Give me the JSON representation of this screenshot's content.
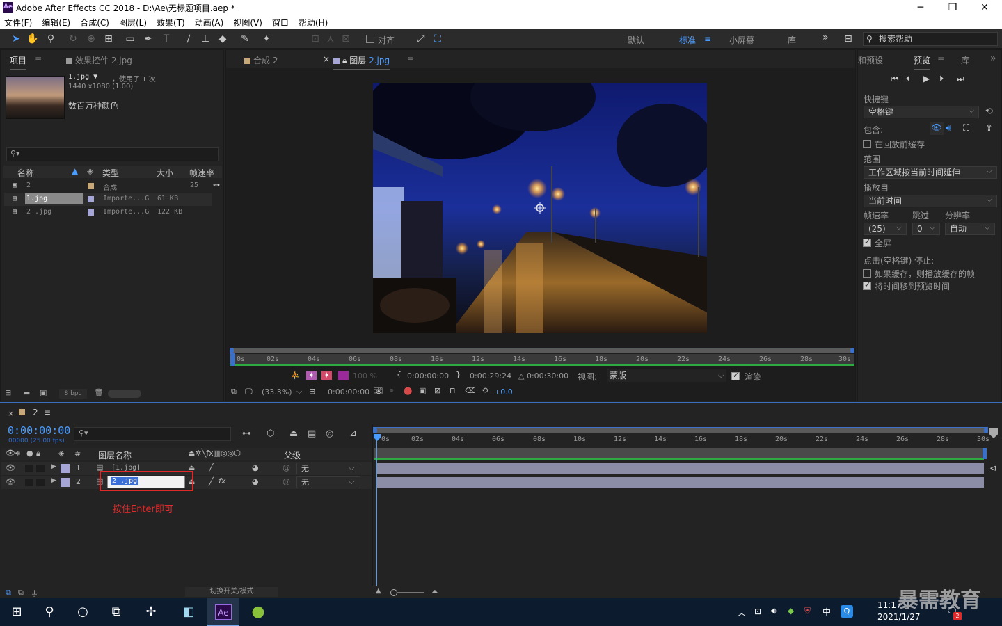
{
  "window": {
    "title": "Adobe After Effects CC 2018 - D:\\Ae\\无标题项目.aep *",
    "logo": "Ae",
    "controls": [
      "─",
      "❐",
      "✕"
    ]
  },
  "menu": [
    "文件(F)",
    "编辑(E)",
    "合成(C)",
    "图层(L)",
    "效果(T)",
    "动画(A)",
    "视图(V)",
    "窗口",
    "帮助(H)"
  ],
  "toolbar": {
    "snap_label": "对齐",
    "workspaces": [
      "默认",
      "标准",
      "小屏幕",
      "库"
    ],
    "active_workspace": "标准",
    "more": "»",
    "search_placeholder": "搜索帮助"
  },
  "project_panel": {
    "tab_project": "项目",
    "tab_effects": "效果控件 2.jpg",
    "selected_name": "1.jpg ▼",
    "used_count": "，使用了 1 次",
    "dimensions": "1440 x1080 (1.00)",
    "colors": "数百万种颜色",
    "search_icon": "⚲▾",
    "columns": [
      "名称",
      "类型",
      "大小",
      "帧速率"
    ],
    "rows": [
      {
        "name": "2",
        "type": "合成",
        "size": "",
        "rate": "25",
        "color": "#c8a878"
      },
      {
        "name": "1.jpg",
        "type": "Importe...G",
        "size": "61 KB",
        "rate": "",
        "color": "#a6a6d6"
      },
      {
        "name": "2 .jpg",
        "type": "Importe...G",
        "size": "122 KB",
        "rate": "",
        "color": "#a6a6d6"
      }
    ],
    "bpc": "8 bpc"
  },
  "comp_viewer": {
    "tab_comp": "合成 2",
    "tab_layer_prefix": "图层",
    "tab_layer_name": "2.jpg",
    "ruler_ticks": [
      "0s",
      "02s",
      "04s",
      "06s",
      "08s",
      "10s",
      "12s",
      "14s",
      "16s",
      "18s",
      "20s",
      "22s",
      "24s",
      "26s",
      "28s",
      "30s"
    ],
    "in_time": "0:00:00:00",
    "out_time": "0:00:29:24",
    "duration": "△ 0:00:30:00",
    "view_label": "视图:",
    "view_value": "蒙版",
    "render_label": "渲染",
    "zoom": "(33.3%)",
    "current_time": "0:00:00:00",
    "exposure": "+0.0",
    "percent": "100 %"
  },
  "preview_panel": {
    "tab_presets": "和预设",
    "tab_preview": "预览",
    "tab_library": "库",
    "shortcut_label": "快捷键",
    "shortcut_value": "空格键",
    "include_label": "包含:",
    "cache_before": "在回放前缓存",
    "range_label": "范围",
    "range_value": "工作区域按当前时间延伸",
    "play_from_label": "播放自",
    "play_from_value": "当前时间",
    "framerate_label": "帧速率",
    "skip_label": "跳过",
    "resolution_label": "分辨率",
    "framerate_value": "(25)",
    "skip_value": "0",
    "resolution_value": "自动",
    "fullscreen": "全屏",
    "stop_label": "点击(空格键) 停止:",
    "if_cached": "如果缓存，则播放缓存的帧",
    "move_time": "将时间移到预览时间"
  },
  "timeline": {
    "tab_name": "2",
    "timecode": "0:00:00:00",
    "fps": "00000 (25.00 fps)",
    "col_layer_name": "图层名称",
    "col_parent": "父级",
    "col_num": "#",
    "ticks": [
      "0s",
      "02s",
      "04s",
      "06s",
      "08s",
      "10s",
      "12s",
      "14s",
      "16s",
      "18s",
      "20s",
      "22s",
      "24s",
      "26s",
      "28s",
      "30s"
    ],
    "layers": [
      {
        "num": "1",
        "name": "[1.jpg]",
        "parent": "无"
      },
      {
        "num": "2",
        "name": "2 .jpg",
        "parent": "无"
      }
    ],
    "annotation": "按住Enter即可",
    "toggle_label": "切换开关/模式"
  },
  "taskbar": {
    "time": "11:17",
    "date": "2021/1/27",
    "ime": "中",
    "notif_count": "2",
    "watermark": "暴需教育"
  }
}
